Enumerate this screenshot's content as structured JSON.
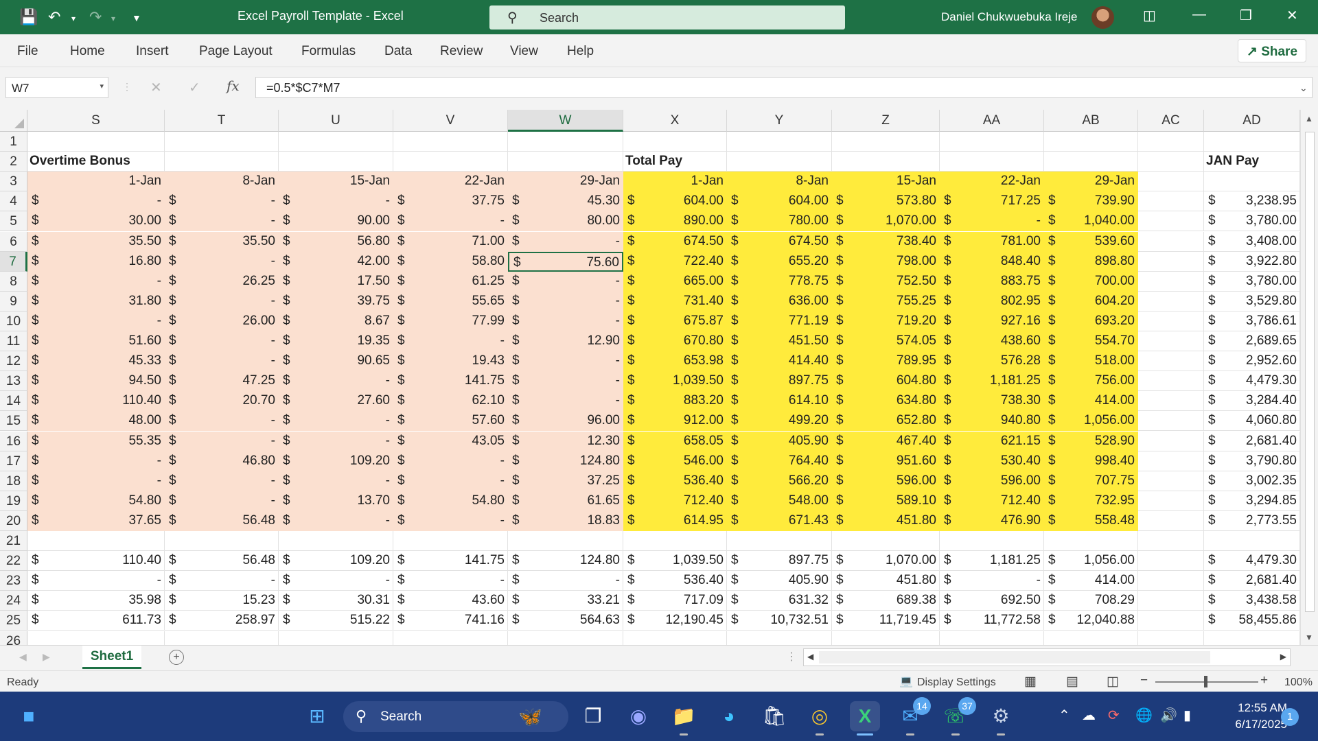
{
  "titlebar": {
    "doc_title": "Excel Payroll Template  -  Excel",
    "search_label": "Search",
    "user_name": "Daniel Chukwuebuka Ireje"
  },
  "menu": {
    "tabs": [
      "File",
      "Home",
      "Insert",
      "Page Layout",
      "Formulas",
      "Data",
      "Review",
      "View",
      "Help"
    ],
    "share_label": "Share"
  },
  "formula_bar": {
    "name_box": "W7",
    "fx": "fx",
    "formula": "=0.5*$C7*M7"
  },
  "sheet": {
    "columns": [
      "S",
      "T",
      "U",
      "V",
      "W",
      "X",
      "Y",
      "Z",
      "AA",
      "AB",
      "AC",
      "AD"
    ],
    "selected_column": "W",
    "selected_row": 7,
    "active_cell": "W7",
    "headings": {
      "overtime": "Overtime Bonus",
      "total": "Total Pay",
      "jan": "JAN Pay"
    },
    "dates": [
      "1-Jan",
      "8-Jan",
      "15-Jan",
      "22-Jan",
      "29-Jan"
    ],
    "currency": "$",
    "rows": [
      {
        "r": 4,
        "ot": [
          "-",
          "-",
          "-",
          "37.75",
          "45.30"
        ],
        "tp": [
          "604.00",
          "604.00",
          "573.80",
          "717.25",
          "739.90"
        ],
        "jan": "3,238.95"
      },
      {
        "r": 5,
        "ot": [
          "30.00",
          "-",
          "90.00",
          "-",
          "80.00"
        ],
        "tp": [
          "890.00",
          "780.00",
          "1,070.00",
          "-",
          "1,040.00"
        ],
        "jan": "3,780.00"
      },
      {
        "r": 6,
        "ot": [
          "35.50",
          "35.50",
          "56.80",
          "71.00",
          "-"
        ],
        "tp": [
          "674.50",
          "674.50",
          "738.40",
          "781.00",
          "539.60"
        ],
        "jan": "3,408.00"
      },
      {
        "r": 7,
        "ot": [
          "16.80",
          "-",
          "42.00",
          "58.80",
          "75.60"
        ],
        "tp": [
          "722.40",
          "655.20",
          "798.00",
          "848.40",
          "898.80"
        ],
        "jan": "3,922.80"
      },
      {
        "r": 8,
        "ot": [
          "-",
          "26.25",
          "17.50",
          "61.25",
          "-"
        ],
        "tp": [
          "665.00",
          "778.75",
          "752.50",
          "883.75",
          "700.00"
        ],
        "jan": "3,780.00"
      },
      {
        "r": 9,
        "ot": [
          "31.80",
          "-",
          "39.75",
          "55.65",
          "-"
        ],
        "tp": [
          "731.40",
          "636.00",
          "755.25",
          "802.95",
          "604.20"
        ],
        "jan": "3,529.80"
      },
      {
        "r": 10,
        "ot": [
          "-",
          "26.00",
          "8.67",
          "77.99",
          "-"
        ],
        "tp": [
          "675.87",
          "771.19",
          "719.20",
          "927.16",
          "693.20"
        ],
        "jan": "3,786.61"
      },
      {
        "r": 11,
        "ot": [
          "51.60",
          "-",
          "19.35",
          "-",
          "12.90"
        ],
        "tp": [
          "670.80",
          "451.50",
          "574.05",
          "438.60",
          "554.70"
        ],
        "jan": "2,689.65"
      },
      {
        "r": 12,
        "ot": [
          "45.33",
          "-",
          "90.65",
          "19.43",
          "-"
        ],
        "tp": [
          "653.98",
          "414.40",
          "789.95",
          "576.28",
          "518.00"
        ],
        "jan": "2,952.60"
      },
      {
        "r": 13,
        "ot": [
          "94.50",
          "47.25",
          "-",
          "141.75",
          "-"
        ],
        "tp": [
          "1,039.50",
          "897.75",
          "604.80",
          "1,181.25",
          "756.00"
        ],
        "jan": "4,479.30"
      },
      {
        "r": 14,
        "ot": [
          "110.40",
          "20.70",
          "27.60",
          "62.10",
          "-"
        ],
        "tp": [
          "883.20",
          "614.10",
          "634.80",
          "738.30",
          "414.00"
        ],
        "jan": "3,284.40"
      },
      {
        "r": 15,
        "ot": [
          "48.00",
          "-",
          "-",
          "57.60",
          "96.00"
        ],
        "tp": [
          "912.00",
          "499.20",
          "652.80",
          "940.80",
          "1,056.00"
        ],
        "jan": "4,060.80"
      },
      {
        "r": 16,
        "ot": [
          "55.35",
          "-",
          "-",
          "43.05",
          "12.30"
        ],
        "tp": [
          "658.05",
          "405.90",
          "467.40",
          "621.15",
          "528.90"
        ],
        "jan": "2,681.40"
      },
      {
        "r": 17,
        "ot": [
          "-",
          "46.80",
          "109.20",
          "-",
          "124.80"
        ],
        "tp": [
          "546.00",
          "764.40",
          "951.60",
          "530.40",
          "998.40"
        ],
        "jan": "3,790.80"
      },
      {
        "r": 18,
        "ot": [
          "-",
          "-",
          "-",
          "-",
          "37.25"
        ],
        "tp": [
          "536.40",
          "566.20",
          "596.00",
          "596.00",
          "707.75"
        ],
        "jan": "3,002.35"
      },
      {
        "r": 19,
        "ot": [
          "54.80",
          "-",
          "13.70",
          "54.80",
          "61.65"
        ],
        "tp": [
          "712.40",
          "548.00",
          "589.10",
          "712.40",
          "732.95"
        ],
        "jan": "3,294.85"
      },
      {
        "r": 20,
        "ot": [
          "37.65",
          "56.48",
          "-",
          "-",
          "18.83"
        ],
        "tp": [
          "614.95",
          "671.43",
          "451.80",
          "476.90",
          "558.48"
        ],
        "jan": "2,773.55"
      },
      {
        "r": 22,
        "ot": [
          "110.40",
          "56.48",
          "109.20",
          "141.75",
          "124.80"
        ],
        "tp": [
          "1,039.50",
          "897.75",
          "1,070.00",
          "1,181.25",
          "1,056.00"
        ],
        "jan": "4,479.30"
      },
      {
        "r": 23,
        "ot": [
          "-",
          "-",
          "-",
          "-",
          "-"
        ],
        "tp": [
          "536.40",
          "405.90",
          "451.80",
          "-",
          "414.00"
        ],
        "jan": "2,681.40"
      },
      {
        "r": 24,
        "ot": [
          "35.98",
          "15.23",
          "30.31",
          "43.60",
          "33.21"
        ],
        "tp": [
          "717.09",
          "631.32",
          "689.38",
          "692.50",
          "708.29"
        ],
        "jan": "3,438.58"
      },
      {
        "r": 25,
        "ot": [
          "611.73",
          "258.97",
          "515.22",
          "741.16",
          "564.63"
        ],
        "tp": [
          "12,190.45",
          "10,732.51",
          "11,719.45",
          "11,772.58",
          "12,040.88"
        ],
        "jan": "58,455.86"
      }
    ]
  },
  "sheet_tabs": {
    "active": "Sheet1",
    "add": "+"
  },
  "status": {
    "ready": "Ready",
    "display_settings": "Display Settings",
    "zoom": "100%"
  },
  "taskbar": {
    "search": "Search",
    "time": "12:55 AM",
    "date": "6/17/2025",
    "badge_outlook": "14",
    "badge_whatsapp": "37",
    "notifications": "1"
  },
  "colors": {
    "excel_green": "#1e7145",
    "overtime_fill": "#fbe0d0",
    "total_fill": "#ffeb3c",
    "taskbar": "#1d3b7b"
  }
}
